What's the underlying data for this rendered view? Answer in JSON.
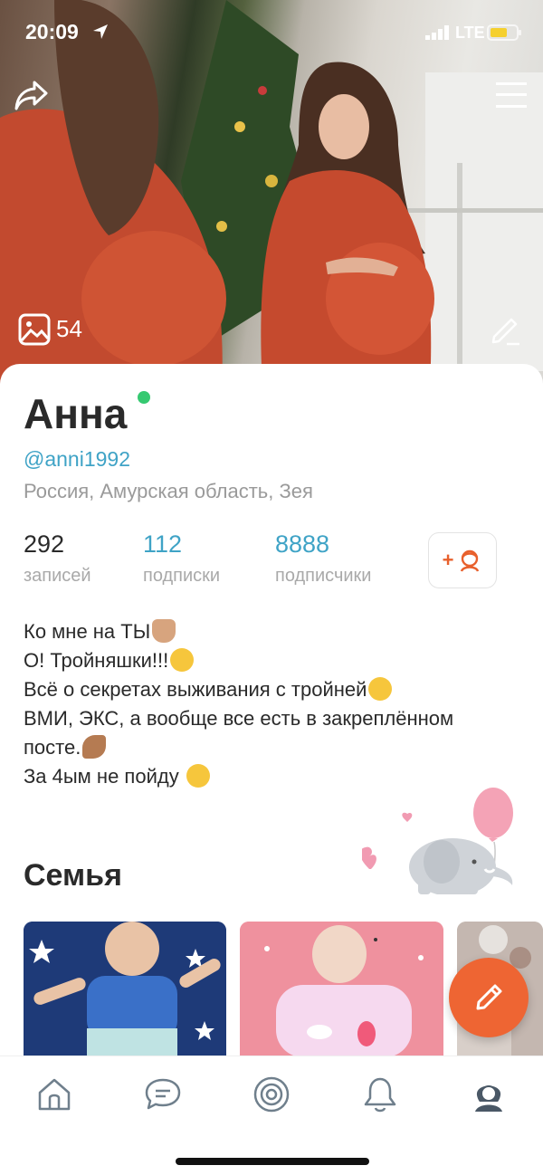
{
  "status_bar": {
    "time": "20:09",
    "network": "LTE"
  },
  "cover": {
    "photo_count": "54"
  },
  "profile": {
    "name": "Анна",
    "username": "@anni1992",
    "location": "Россия, Амурская область, Зея",
    "online": true
  },
  "stats": [
    {
      "value": "292",
      "label": "записей"
    },
    {
      "value": "112",
      "label": "подписки"
    },
    {
      "value": "8888",
      "label": "подписчики"
    }
  ],
  "follow_button": {
    "label": "+"
  },
  "bio": [
    "Ко мне на ТЫ",
    "О! Тройняшки!!!",
    "Всё о секретах выживания с тройней",
    "ВМИ, ЭКС, а вообще все есть в закреплённом",
    "посте.",
    "За 4ым не пойду "
  ],
  "family": {
    "title": "Семья"
  },
  "tabs": [
    "home-icon",
    "chat-icon",
    "target-icon",
    "bell-icon",
    "profile-icon"
  ],
  "colors": {
    "accent": "#ee6533",
    "link": "#3fa3c6",
    "online": "#36c971",
    "muted": "#9a9a9a"
  }
}
